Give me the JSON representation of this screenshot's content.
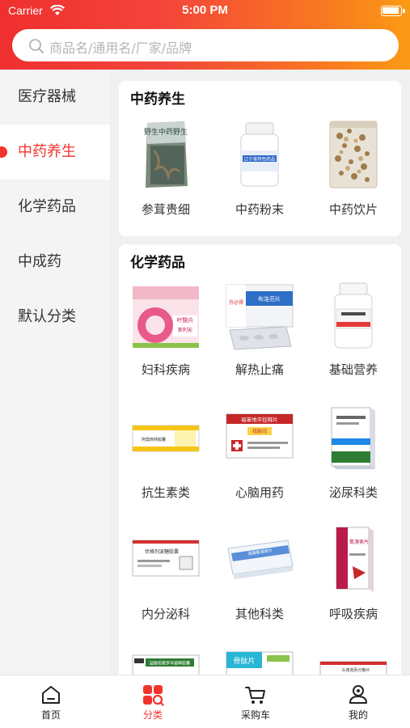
{
  "status": {
    "carrier": "Carrier",
    "time": "5:00 PM"
  },
  "search": {
    "placeholder": "商品名/通用名/厂家/品牌"
  },
  "sidebar": {
    "items": [
      {
        "label": "医疗器械",
        "active": false
      },
      {
        "label": "中药养生",
        "active": true
      },
      {
        "label": "化学药品",
        "active": false
      },
      {
        "label": "中成药",
        "active": false
      },
      {
        "label": "默认分类",
        "active": false
      }
    ]
  },
  "sections": [
    {
      "title": "中药养生",
      "products": [
        "参茸贵细",
        "中药粉末",
        "中药饮片"
      ]
    },
    {
      "title": "化学药品",
      "products": [
        "妇科疾病",
        "解热止痛",
        "基础营养",
        "抗生素类",
        "心脑用药",
        "泌尿科类",
        "内分泌科",
        "其他科类",
        "呼吸疾病"
      ]
    }
  ],
  "package_text": {
    "herb_bag": "野生中药野生",
    "fenmo": "辽宁省特色药品",
    "folic": "叶酸片",
    "folic_brand": "斯利安",
    "jiere": "布洛芬片",
    "jiere_brand": "芬必得",
    "kang": "阿莫西林胶囊",
    "xinnao": "硝苯地平控释片",
    "xinnao_brand": "拜新同",
    "mini": "盐酸坦索罗辛缓释胶囊",
    "neifen": "伏格列波糖胶囊",
    "qita": "盐酸氨溴索片",
    "huxi": "氨溴索片",
    "gutai": "骨肽片",
    "last": "头孢克肟分散片"
  },
  "tabbar": {
    "items": [
      {
        "label": "首页",
        "icon": "home-icon",
        "active": false
      },
      {
        "label": "分类",
        "icon": "category-icon",
        "active": true
      },
      {
        "label": "采购车",
        "icon": "cart-icon",
        "active": false
      },
      {
        "label": "我的",
        "icon": "profile-icon",
        "active": false
      }
    ]
  },
  "colors": {
    "accent": "#f0342d",
    "header_start": "#ef2f2f",
    "header_end": "#fb9a14"
  }
}
